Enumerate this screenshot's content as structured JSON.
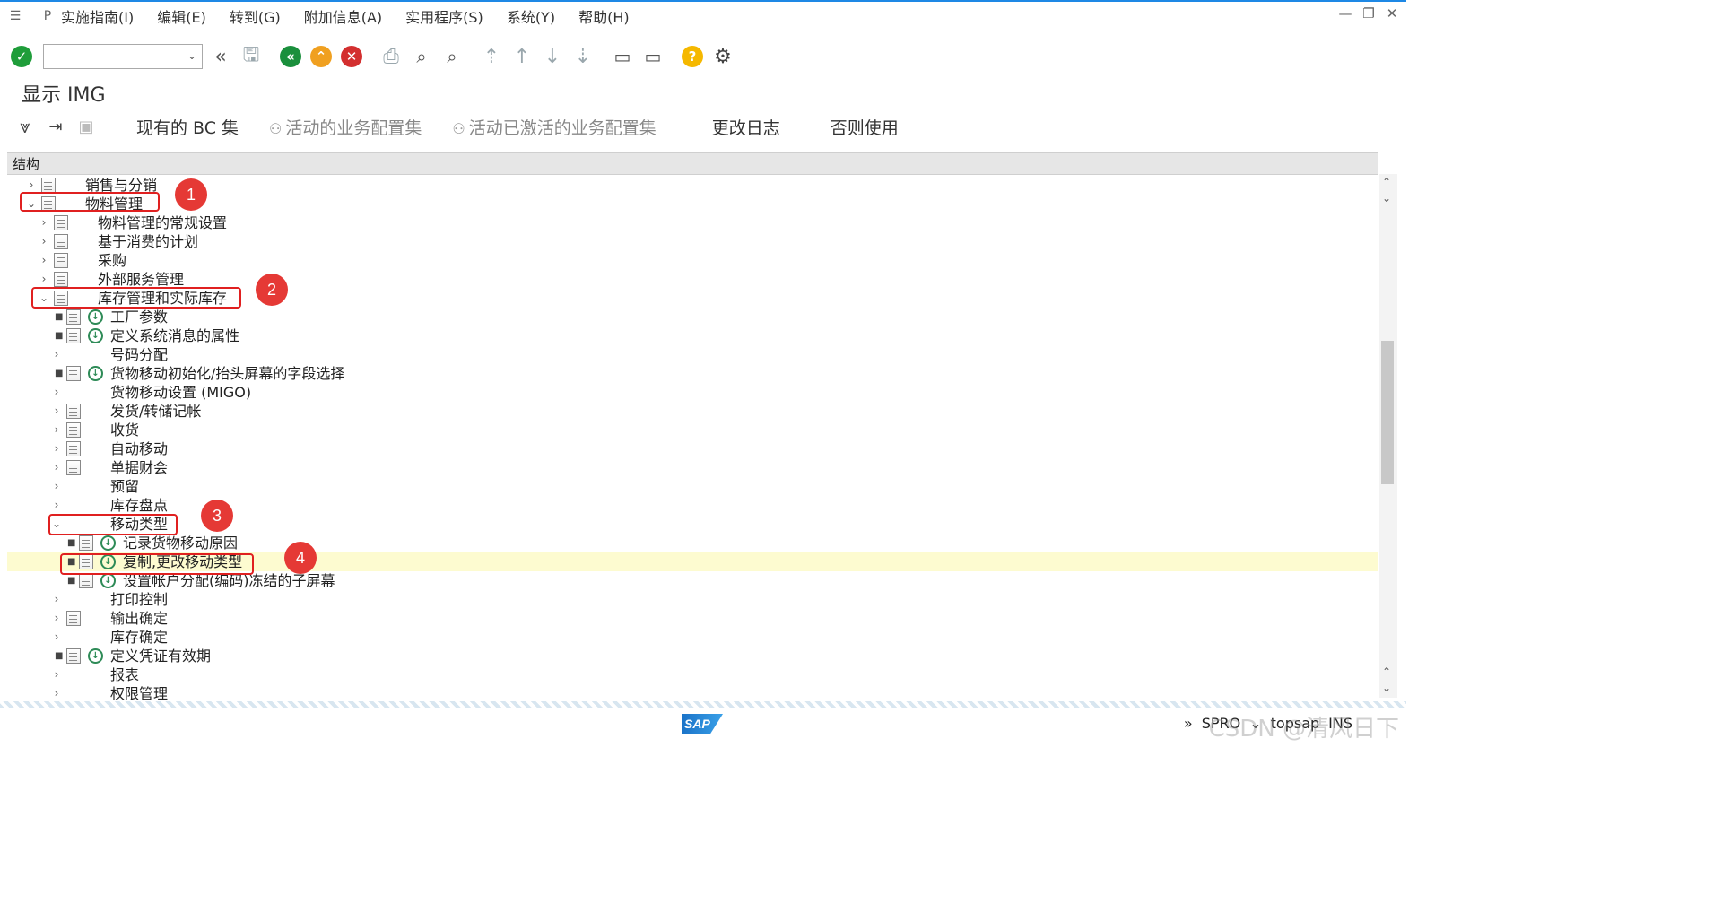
{
  "menubar": {
    "items": [
      "实施指南(I)",
      "编辑(E)",
      "转到(G)",
      "附加信息(A)",
      "实用程序(S)",
      "系统(Y)",
      "帮助(H)"
    ]
  },
  "toolbar": {
    "command_value": "",
    "icons": [
      "check-icon",
      "double-left-icon",
      "save-icon",
      "back-icon",
      "exit-icon",
      "cancel-icon",
      "print-icon",
      "find-icon",
      "find-next-icon",
      "first-page-icon",
      "prev-page-icon",
      "next-page-icon",
      "last-page-icon",
      "create-session-icon",
      "shortcut-icon",
      "help-icon",
      "settings-icon"
    ]
  },
  "page": {
    "title": "显示 IMG"
  },
  "app_toolbar": {
    "existing_bc_sets": "现有的 BC 集",
    "active_business_config_sets": "活动的业务配置集",
    "activated_business_config_sets": "活动已激活的业务配置集",
    "change_log": "更改日志",
    "where_used": "否则使用"
  },
  "tree": {
    "header": "结构",
    "rows": [
      {
        "label": "销售与分销"
      },
      {
        "label": "物料管理"
      },
      {
        "label": "物料管理的常规设置"
      },
      {
        "label": "基于消费的计划"
      },
      {
        "label": "采购"
      },
      {
        "label": "外部服务管理"
      },
      {
        "label": "库存管理和实际库存"
      },
      {
        "label": "工厂参数"
      },
      {
        "label": "定义系统消息的属性"
      },
      {
        "label": "号码分配"
      },
      {
        "label": "货物移动初始化/抬头屏幕的字段选择"
      },
      {
        "label": "货物移动设置 (MIGO)"
      },
      {
        "label": "发货/转储记帐"
      },
      {
        "label": "收货"
      },
      {
        "label": "自动移动"
      },
      {
        "label": "单据财会"
      },
      {
        "label": "预留"
      },
      {
        "label": "库存盘点"
      },
      {
        "label": "移动类型"
      },
      {
        "label": "记录货物移动原因"
      },
      {
        "label": "复制,更改移动类型"
      },
      {
        "label": "设置帐户分配(编码)冻结的子屏幕"
      },
      {
        "label": "打印控制"
      },
      {
        "label": "输出确定"
      },
      {
        "label": "库存确定"
      },
      {
        "label": "定义凭证有效期"
      },
      {
        "label": "报表"
      },
      {
        "label": "权限管理"
      }
    ],
    "selected_index": 20
  },
  "annotations": [
    "1",
    "2",
    "3",
    "4"
  ],
  "status": {
    "transaction": "SPRO",
    "server": "topsap",
    "mode": "INS",
    "watermark": "CSDN @清风日下",
    "logo_text": "SAP"
  },
  "colors": {
    "accent_blue": "#1e88e5",
    "ok_green": "#1f9d3a",
    "back_green": "#1a8f3c",
    "exit_orange": "#f0a020",
    "cancel_red": "#d32f2f",
    "help_yellow": "#f5b800",
    "annotation_red": "#e53935",
    "selected_row": "#fdfbd0"
  }
}
